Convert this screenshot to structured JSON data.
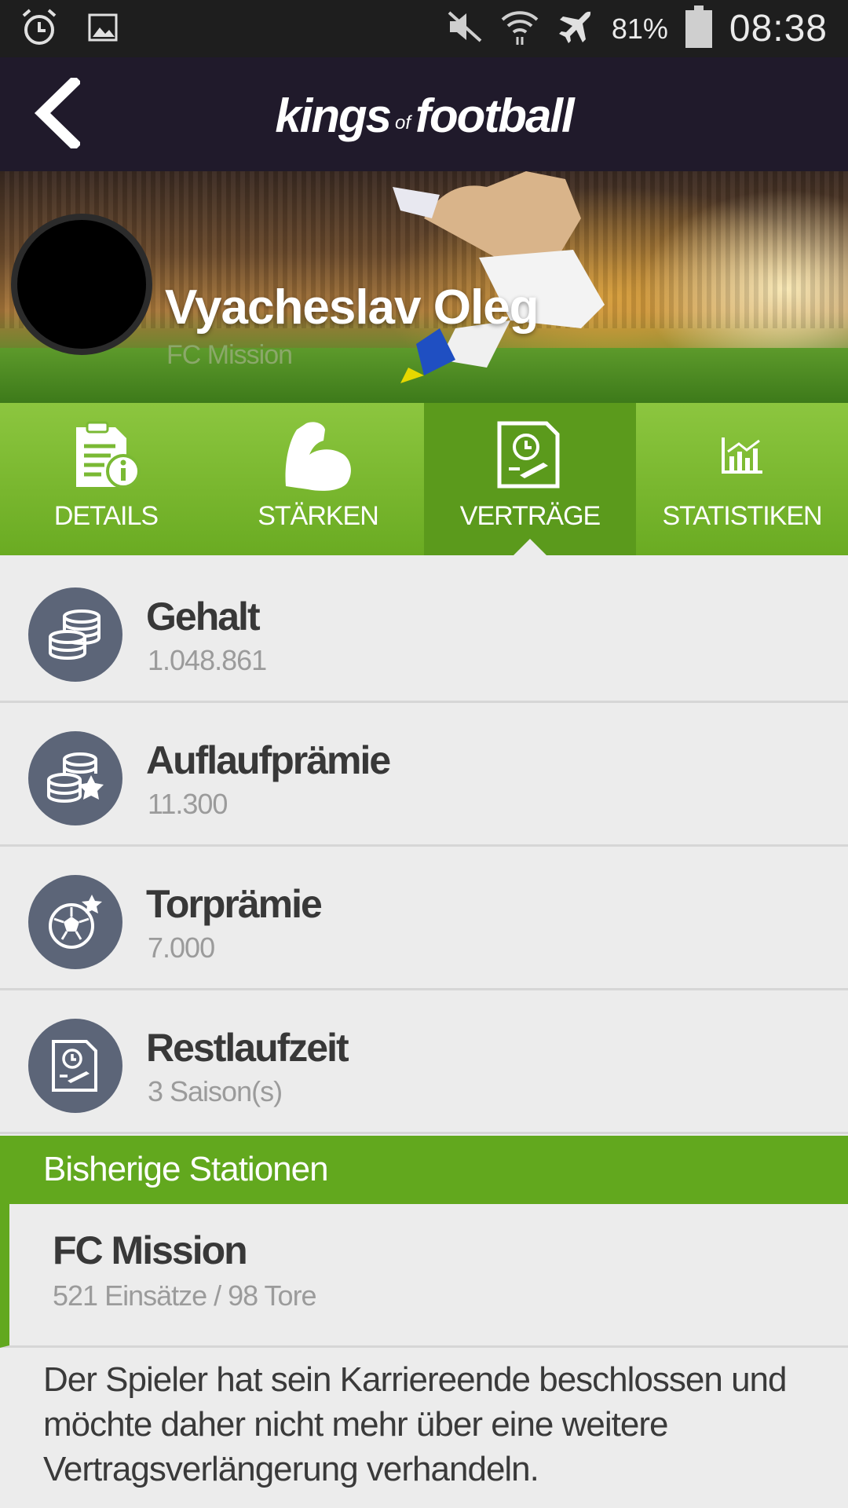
{
  "statusbar": {
    "time": "08:38",
    "battery_percent": "81%",
    "icons": [
      "alarm-icon",
      "image-icon",
      "mute-icon",
      "wifi-icon",
      "airplane-icon",
      "battery-icon"
    ]
  },
  "appbar": {
    "logo_left": "kings",
    "logo_mid": "of",
    "logo_right": "football",
    "back_icon": "chevron-left-icon"
  },
  "profile": {
    "name": "Vyacheslav Oleg",
    "club": "FC Mission"
  },
  "tabs": [
    {
      "label": "DETAILS",
      "icon": "document-info-icon",
      "active": false
    },
    {
      "label": "STÄRKEN",
      "icon": "bicep-icon",
      "active": false
    },
    {
      "label": "VERTRÄGE",
      "icon": "contract-clock-icon",
      "active": true
    },
    {
      "label": "STATISTIKEN",
      "icon": "chart-icon",
      "active": false
    }
  ],
  "contract": [
    {
      "title": "Gehalt",
      "value": "1.048.861",
      "icon": "coins-icon"
    },
    {
      "title": "Auflaufprämie",
      "value": "11.300",
      "icon": "coins-star-icon"
    },
    {
      "title": "Torprämie",
      "value": "7.000",
      "icon": "football-star-icon"
    },
    {
      "title": "Restlaufzeit",
      "value": "3 Saison(s)",
      "icon": "contract-clock-icon"
    }
  ],
  "stations": {
    "heading": "Bisherige Stationen",
    "items": [
      {
        "club": "FC Mission",
        "meta": "521 Einsätze / 98 Tore"
      }
    ]
  },
  "note": "Der Spieler hat sein Karriereende beschlossen und möchte daher nicht mehr über eine weitere Vertragsverlängerung verhandeln.",
  "colors": {
    "appbar": "#201a2b",
    "tab_green": "#7ab934",
    "tab_active": "#5b9a1c",
    "icon_circle": "#5c6578",
    "section_green": "#62a81e"
  }
}
